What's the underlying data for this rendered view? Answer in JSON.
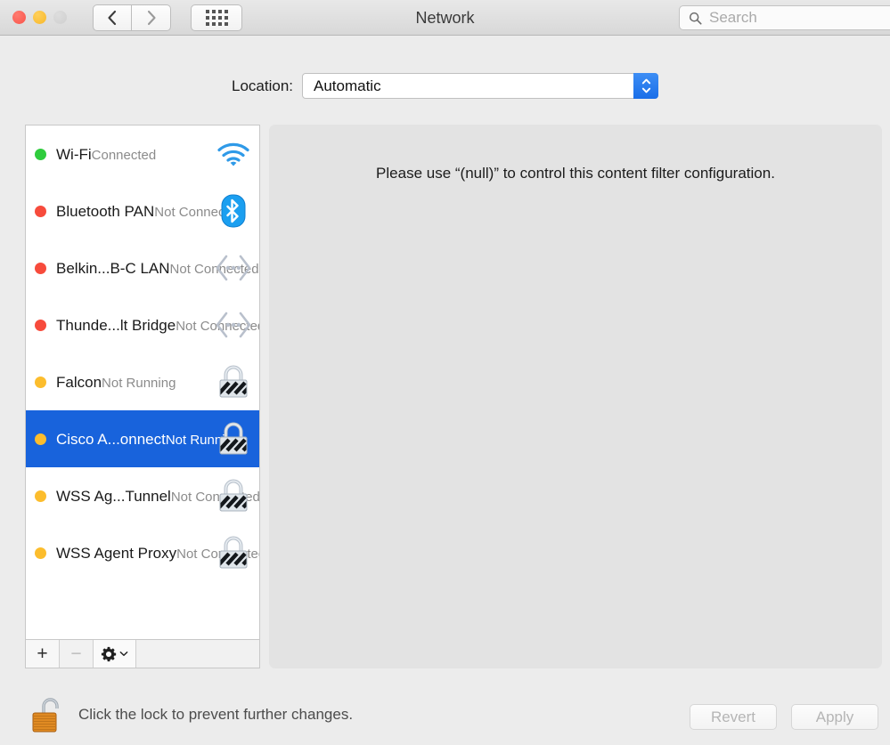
{
  "window": {
    "title": "Network",
    "traffic_lights": [
      "close",
      "minimize",
      "zoom"
    ],
    "nav": {
      "back_label": "‹",
      "forward_label": "›"
    },
    "grid_button": "show-all-icon",
    "search": {
      "placeholder": "Search",
      "value": "",
      "icon": "search-icon"
    }
  },
  "location": {
    "label": "Location:",
    "selected": "Automatic",
    "options": [
      "Automatic"
    ]
  },
  "services": [
    {
      "name": "Wi-Fi",
      "status": "Connected",
      "dot": "green",
      "dot_color": "#2fcc3d",
      "icon": "wifi-icon",
      "selected": false
    },
    {
      "name": "Bluetooth PAN",
      "status": "Not Connected",
      "dot": "red",
      "dot_color": "#f74b3c",
      "icon": "bluetooth-icon",
      "selected": false
    },
    {
      "name": "Belkin...B-C LAN",
      "status": "Not Connected",
      "dot": "red",
      "dot_color": "#f74b3c",
      "icon": "ethernet-icon",
      "selected": false
    },
    {
      "name": "Thunde...lt Bridge",
      "status": "Not Connected",
      "dot": "red",
      "dot_color": "#f74b3c",
      "icon": "ethernet-icon",
      "selected": false
    },
    {
      "name": "Falcon",
      "status": "Not Running",
      "dot": "yellow",
      "dot_color": "#fcbd2d",
      "icon": "vpn-lock-icon",
      "selected": false
    },
    {
      "name": "Cisco A...onnect",
      "status": "Not Running",
      "dot": "yellow",
      "dot_color": "#fcbd2d",
      "icon": "vpn-lock-icon",
      "selected": true
    },
    {
      "name": "WSS Ag...Tunnel",
      "status": "Not Connected",
      "dot": "yellow",
      "dot_color": "#fcbd2d",
      "icon": "vpn-lock-icon",
      "selected": false
    },
    {
      "name": "WSS Agent Proxy",
      "status": "Not Connected",
      "dot": "yellow",
      "dot_color": "#fcbd2d",
      "icon": "vpn-lock-icon",
      "selected": false
    }
  ],
  "list_toolbar": {
    "add_label": "+",
    "remove_label": "−",
    "gear_icon": "gear-icon",
    "gear_chevron": "chevron-down-icon"
  },
  "content": {
    "message": "Please use “(null)” to control this content filter configuration."
  },
  "footer": {
    "lock_icon": "lock-open-icon",
    "lock_text": "Click the lock to prevent further changes.",
    "revert_label": "Revert",
    "apply_label": "Apply"
  },
  "colors": {
    "selection_blue": "#1863dc",
    "popup_arrow_blue": "#1a6ee8",
    "status_green": "#2fcc3d",
    "status_red": "#f74b3c",
    "status_yellow": "#fcbd2d"
  }
}
